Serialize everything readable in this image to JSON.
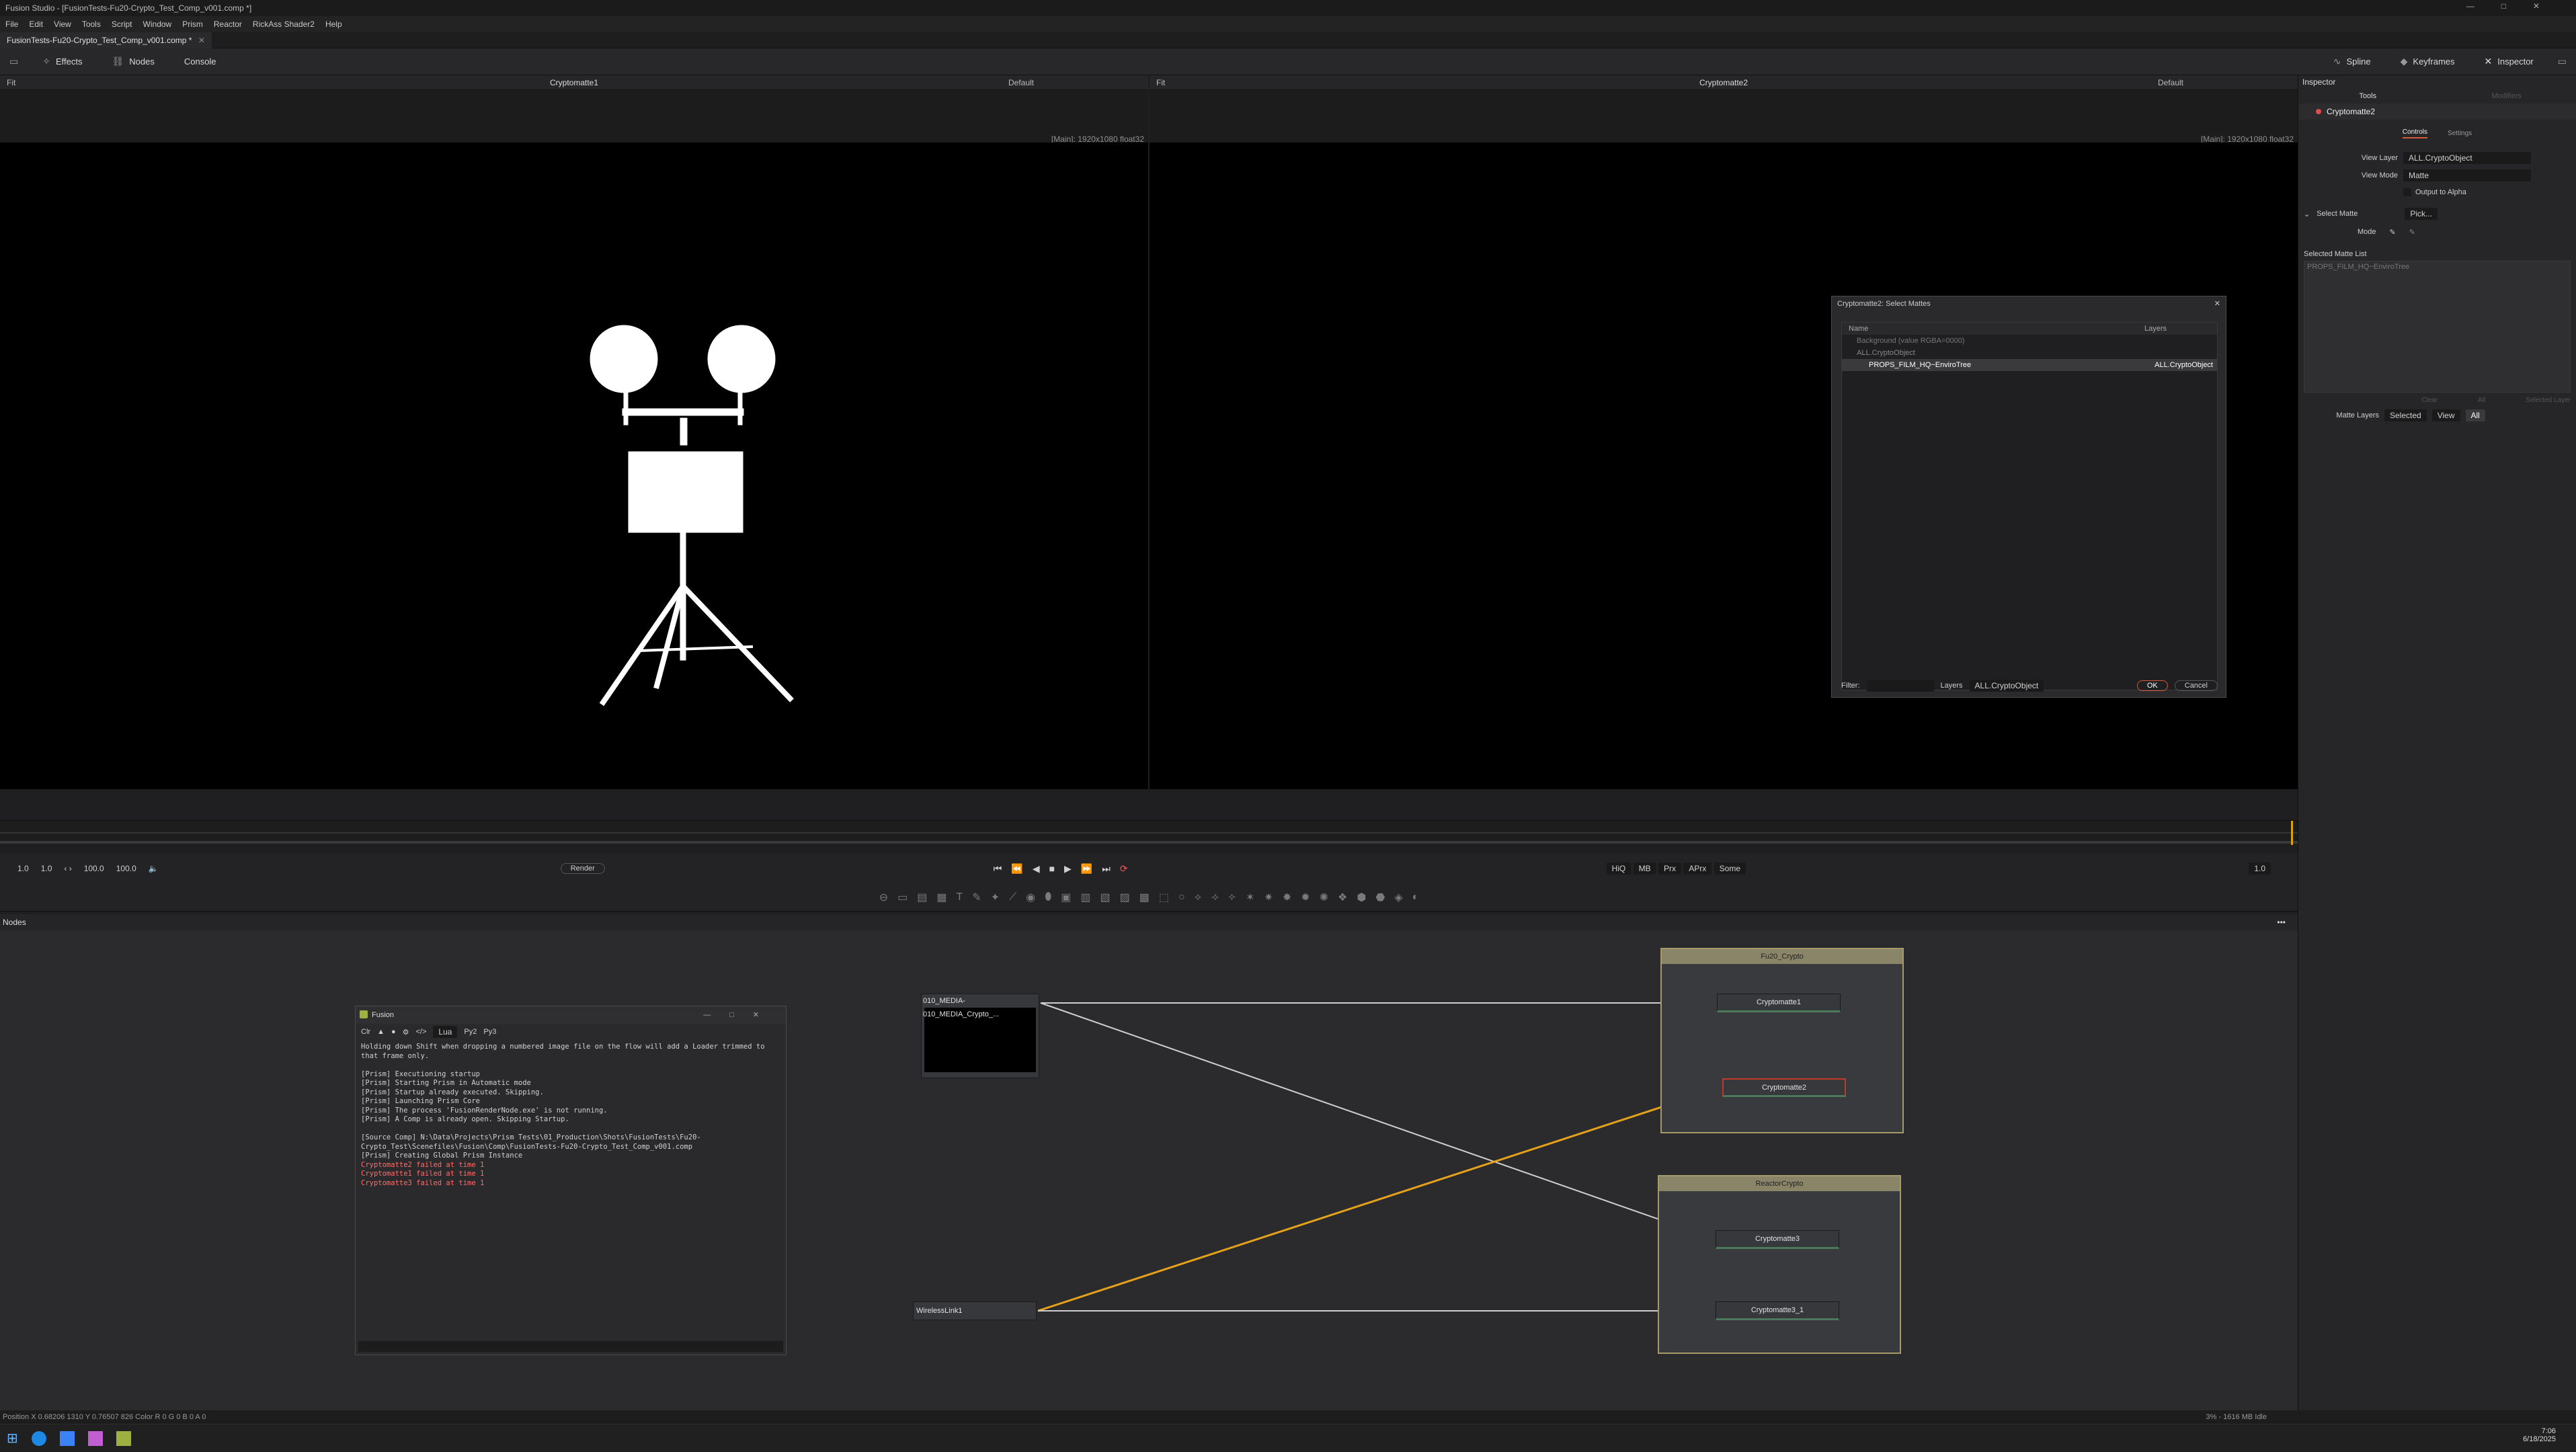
{
  "window": {
    "title": "Fusion Studio - [FusionTests-Fu20-Crypto_Test_Comp_v001.comp *]"
  },
  "menus": [
    "File",
    "Edit",
    "View",
    "Tools",
    "Script",
    "Window",
    "Prism",
    "Reactor",
    "RickAss Shader2",
    "Help"
  ],
  "doc_tab": "FusionTests-Fu20-Crypto_Test_Comp_v001.comp *",
  "toolbar": {
    "effects": "Effects",
    "nodes": "Nodes",
    "console": "Console",
    "spline": "Spline",
    "keyframes": "Keyframes",
    "inspector": "Inspector"
  },
  "viewer1": {
    "fit": "Fit",
    "title": "Cryptomatte1",
    "default": "Default",
    "info": "[Main]: 1920x1080 float32"
  },
  "viewer2": {
    "fit": "Fit",
    "title": "Cryptomatte2",
    "default": "Default",
    "info": "[Main]: 1920x1080 float32"
  },
  "transport": {
    "start": "1.0",
    "in": "1.0",
    "out": "100.0",
    "end": "100.0",
    "render": "Render",
    "current": "1.0",
    "quality": [
      "HiQ",
      "MB",
      "Prx",
      "APrx",
      "Some"
    ]
  },
  "inspector": {
    "title": "Inspector",
    "tabs_tools": "Tools",
    "tabs_mod": "Modifiers",
    "node_name": "Cryptomatte2",
    "controls": "Controls",
    "settings": "Settings",
    "view_layer_label": "View Layer",
    "view_layer_value": "ALL.CryptoObject",
    "view_mode_label": "View Mode",
    "view_mode_value": "Matte",
    "output_alpha": "Output to Alpha",
    "select_matte": "Select Matte",
    "pick": "Pick...",
    "mode": "Mode",
    "selected_list_label": "Selected Matte List",
    "selected_item": "PROPS_FILM_HQ~EnviroTree",
    "clear": "Clear",
    "all": "All",
    "selected_layer": "Selected Layer",
    "matte_layers": "Matte Layers",
    "ml_selected": "Selected",
    "ml_view": "View",
    "ml_all": "All"
  },
  "dialog": {
    "title": "Cryptomatte2: Select Mattes",
    "col_name": "Name",
    "col_layers": "Layers",
    "row_bg": "Background (value RGBA=0000)",
    "row_group": "ALL.CryptoObject",
    "row_item": "PROPS_FILM_HQ~EnviroTree",
    "row_item_layer": "ALL.CryptoObject",
    "filter": "Filter:",
    "layers": "Layers",
    "layers_value": "ALL.CryptoObject",
    "ok": "OK",
    "cancel": "Cancel"
  },
  "nodes_panel": {
    "title": "Nodes"
  },
  "nodes": {
    "loader": "010_MEDIA-010_MEDIA_Crypto_...",
    "group1": "Fu20_Crypto",
    "group2": "ReactorCrypto",
    "c1": "Cryptomatte1",
    "c2": "Cryptomatte2",
    "c3": "Cryptomatte3",
    "c3_1": "Cryptomatte3_1",
    "wireless": "WirelessLink1"
  },
  "console": {
    "title": "Fusion",
    "tabs": [
      "Lua",
      "Py2",
      "Py3"
    ],
    "lines": [
      "Holding down Shift when dropping a numbered image file on the flow will add a Loader trimmed to",
      "that frame only.",
      "",
      "[Prism] Executioning startup",
      "[Prism] Starting Prism in Automatic mode",
      "[Prism] Startup already executed. Skipping.",
      "[Prism] Launching Prism Core",
      "[Prism] The process 'FusionRenderNode.exe' is not running.",
      "[Prism] A Comp is already open. Skipping Startup.",
      "",
      "[Source Comp] N:\\Data\\Projects\\Prism Tests\\01_Production\\Shots\\FusionTests\\Fu20-",
      "Crypto_Test\\Scenefiles\\Fusion\\Comp\\FusionTests-Fu20-Crypto_Test_Comp_v001.comp",
      "[Prism] Creating Global Prism Instance"
    ],
    "errors": [
      "Cryptomatte2 failed at time 1",
      "Cryptomatte1 failed at time 1",
      "Cryptomatte3 failed at time 1"
    ]
  },
  "status": {
    "left": "Position  X 0.68206   1310   Y 0.76507   826      Color  R 0          G 0          B 0          A 0",
    "right": "3% - 1616 MB   Idle",
    "time": "7:06",
    "date": "6/18/2025"
  }
}
